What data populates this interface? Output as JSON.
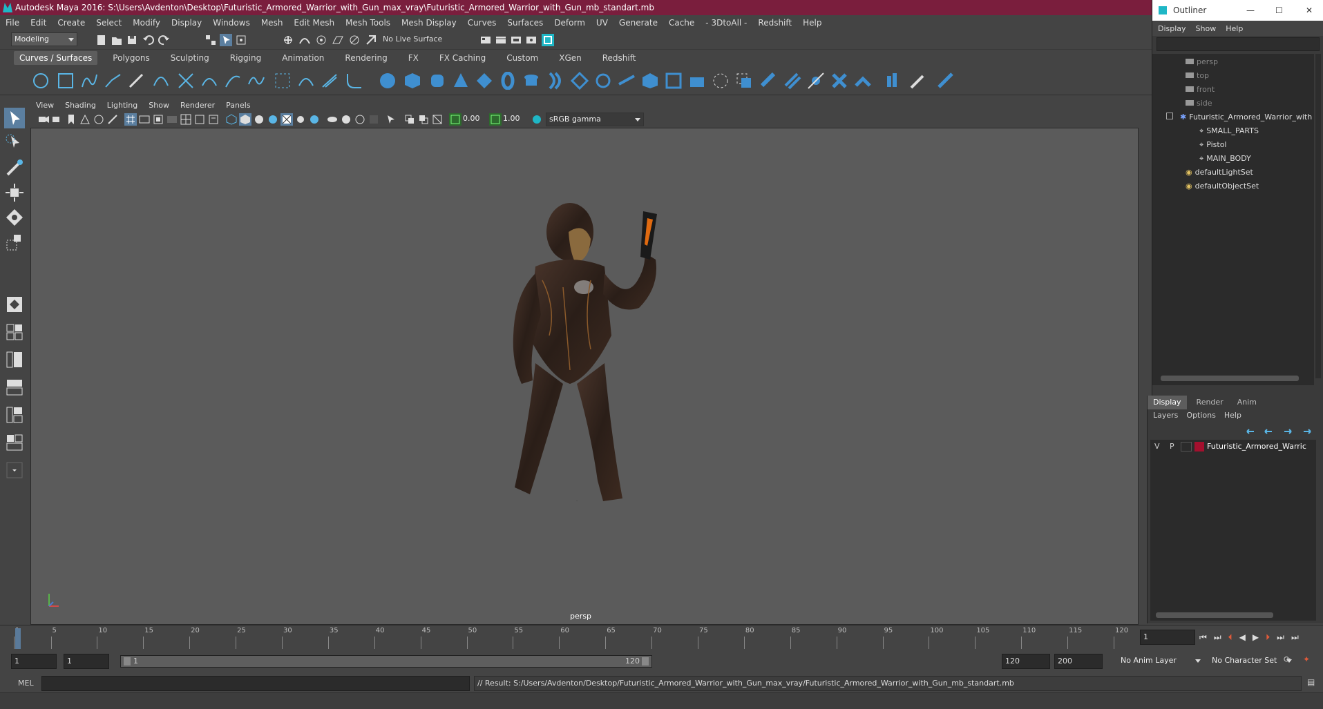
{
  "window": {
    "title": "Autodesk Maya 2016: S:\\Users\\Avdenton\\Desktop\\Futuristic_Armored_Warrior_with_Gun_max_vray\\Futuristic_Armored_Warrior_with_Gun_mb_standart.mb"
  },
  "menubar": [
    "File",
    "Edit",
    "Create",
    "Select",
    "Modify",
    "Display",
    "Windows",
    "Mesh",
    "Edit Mesh",
    "Mesh Tools",
    "Mesh Display",
    "Curves",
    "Surfaces",
    "Deform",
    "UV",
    "Generate",
    "Cache",
    "- 3DtoAll -",
    "Redshift",
    "Help"
  ],
  "statusline": {
    "mode": "Modeling",
    "live_surface": "No Live Surface"
  },
  "shelf_tabs": [
    "Curves / Surfaces",
    "Polygons",
    "Sculpting",
    "Rigging",
    "Animation",
    "Rendering",
    "FX",
    "FX Caching",
    "Custom",
    "XGen",
    "Redshift"
  ],
  "shelf_active": "Curves / Surfaces",
  "viewport": {
    "menu": [
      "View",
      "Shading",
      "Lighting",
      "Show",
      "Renderer",
      "Panels"
    ],
    "exposure": "0.00",
    "gamma": "1.00",
    "color_space": "sRGB gamma",
    "camera_label": "persp"
  },
  "outliner": {
    "title": "Outliner",
    "menu": [
      "Display",
      "Show",
      "Help"
    ],
    "items": [
      {
        "label": "persp"
      },
      {
        "label": "top"
      },
      {
        "label": "front"
      },
      {
        "label": "side"
      },
      {
        "label": "Futuristic_Armored_Warrior_with"
      },
      {
        "label": "SMALL_PARTS"
      },
      {
        "label": "Pistol"
      },
      {
        "label": "MAIN_BODY"
      },
      {
        "label": "defaultLightSet"
      },
      {
        "label": "defaultObjectSet"
      }
    ]
  },
  "layers": {
    "tabs": [
      "Display",
      "Render",
      "Anim"
    ],
    "menu": [
      "Layers",
      "Options",
      "Help"
    ],
    "row": {
      "v": "V",
      "p": "P",
      "name": "Futuristic_Armored_Warric",
      "color": "#a3102e"
    }
  },
  "timeslider": {
    "ticks": [
      "1",
      "5",
      "10",
      "15",
      "20",
      "25",
      "30",
      "35",
      "40",
      "45",
      "50",
      "55",
      "60",
      "65",
      "70",
      "75",
      "80",
      "85",
      "90",
      "95",
      "100",
      "105",
      "110",
      "115",
      "120"
    ],
    "current_frame": "1"
  },
  "range": {
    "start": "1",
    "start2": "1",
    "range_start": "1",
    "range_end": "120",
    "end": "120",
    "end2": "200",
    "anim_layer": "No Anim Layer",
    "char_set": "No Character Set"
  },
  "cmdline": {
    "lang": "MEL",
    "result": "// Result: S:/Users/Avdenton/Desktop/Futuristic_Armored_Warrior_with_Gun_max_vray/Futuristic_Armored_Warrior_with_Gun_mb_standart.mb"
  },
  "colors": {
    "accent": "#1fb7c6",
    "titlebar": "#7a1e3d",
    "layer": "#a3102e"
  }
}
